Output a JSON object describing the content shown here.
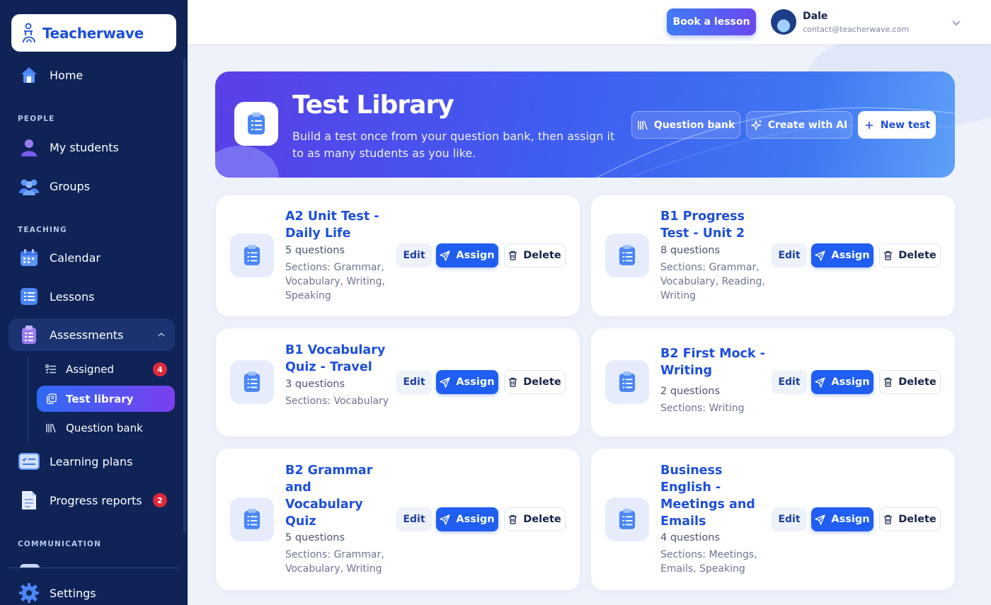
{
  "brand": {
    "name": "Teacherwave"
  },
  "sidebar": {
    "home": "Home",
    "sections": {
      "people": "PEOPLE",
      "teaching": "TEACHING",
      "communication": "COMMUNICATION"
    },
    "my_students": "My students",
    "groups": "Groups",
    "calendar": "Calendar",
    "lessons": "Lessons",
    "assessments": "Assessments",
    "assessments_sub": [
      {
        "label": "Assigned",
        "badge": "4"
      },
      {
        "label": "Test library"
      },
      {
        "label": "Question bank"
      }
    ],
    "learning_plans": "Learning plans",
    "progress_reports": "Progress reports",
    "progress_badge": "2",
    "settings": "Settings"
  },
  "topbar": {
    "book_label": "Book a lesson",
    "user_name": "Dale",
    "user_email": "contact@teacherwave.com"
  },
  "hero": {
    "title": "Test Library",
    "subtitle": "Build a test once from your question bank, then assign it to as many students as you like.",
    "question_bank": "Question bank",
    "create_ai": "Create with AI",
    "new_test": "New test"
  },
  "actions": {
    "edit": "Edit",
    "assign": "Assign",
    "delete": "Delete"
  },
  "tests": [
    {
      "title": "A2 Unit Test - Daily Life",
      "questions": "5 questions",
      "sections": "Sections: Grammar, Vocabulary, Writing, Speaking"
    },
    {
      "title": "B1 Progress Test - Unit 2",
      "questions": "8 questions",
      "sections": "Sections: Grammar, Vocabulary, Reading, Writing"
    },
    {
      "title": "B1 Vocabulary Quiz - Travel",
      "questions": "3 questions",
      "sections": "Sections: Vocabulary"
    },
    {
      "title": "B2 First Mock - Writing",
      "questions": "2 questions",
      "sections": "Sections: Writing"
    },
    {
      "title": "B2 Grammar and Vocabulary Quiz",
      "questions": "5 questions",
      "sections": "Sections: Grammar, Vocabulary, Writing"
    },
    {
      "title": "Business English - Meetings and Emails",
      "questions": "4 questions",
      "sections": "Sections: Meetings, Emails, Speaking"
    }
  ],
  "colors": {
    "sidebar_bg": "#0f2357",
    "accent": "#1f5ef0",
    "brand_blue": "#1d4fd8",
    "badge_red": "#e02a3a"
  },
  "icons": [
    "home-icon",
    "student-icon",
    "groups-icon",
    "calendar-icon",
    "lessons-icon",
    "clipboard-icon",
    "list-icon",
    "stack-icon",
    "library-icon",
    "plan-icon",
    "report-icon",
    "gear-icon",
    "send-icon",
    "trash-icon",
    "sparkle-icon",
    "plus-icon",
    "chevron-down-icon",
    "chevron-up-icon"
  ]
}
